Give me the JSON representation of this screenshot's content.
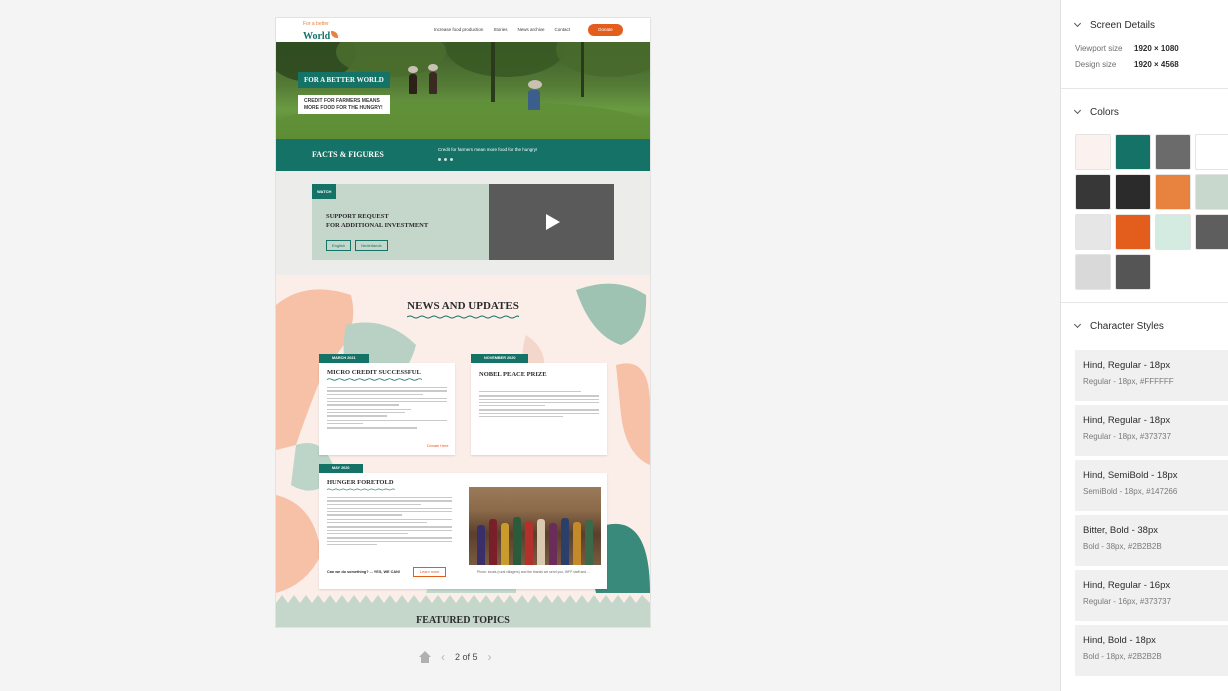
{
  "artboard": {
    "nav": {
      "logo_tag": "For a better",
      "logo_word": "World",
      "links": [
        "Increase food production",
        "Stories",
        "News archive",
        "Contact"
      ],
      "donate_label": "Donate"
    },
    "hero": {
      "badge": "FOR A BETTER WORLD",
      "subtitle": "CREDIT FOR FARMERS MEANS MORE FOOD FOR THE HUNGRY!"
    },
    "facts": {
      "title": "FACTS & FIGURES",
      "text": "Credit for farmers mean more food for the hungry!"
    },
    "watch": {
      "tag": "WATCH",
      "heading_line1": "SUPPORT REQUEST",
      "heading_line2": "FOR ADDITIONAL INVESTMENT",
      "lang1": "English",
      "lang2": "Nederlands"
    },
    "news": {
      "title": "NEWS AND UPDATES",
      "cards": [
        {
          "date": "MARCH 2021",
          "title": "MICRO CREDIT SUCCESSFUL",
          "more": "Donate Here"
        },
        {
          "date": "NOVEMBER 2020",
          "title": "NOBEL PEACE PRIZE"
        },
        {
          "date": "MAY 2020",
          "title": "HUNGER FORETOLD",
          "cta": "Can we do something? ... YES, WE CAN!",
          "learn": "Learn more",
          "caption": "Photo: locals (rural villagers) and the thanks we send you, WFP staff and ..."
        }
      ]
    },
    "featured": "FEATURED TOPICS"
  },
  "pager": {
    "page_count": "2 of 5"
  },
  "panel": {
    "screen_details": {
      "title": "Screen Details",
      "viewport_label": "Viewport size",
      "viewport_value": "1920 × 1080",
      "design_label": "Design size",
      "design_value": "1920 × 4568"
    },
    "colors": {
      "title": "Colors",
      "swatches": [
        "#fbf1ee",
        "#147266",
        "#6b6b6b",
        "#ffffff",
        "#373737",
        "#2b2b2b",
        "#e8823f",
        "#c8d8cc",
        "#e6e6e6",
        "#e35d1d",
        "#d4ebe1",
        "#5e5e5e",
        "#d9d9d9",
        "#555555"
      ]
    },
    "character_styles": {
      "title": "Character Styles",
      "styles": [
        {
          "name": "Hind, Regular - 18px",
          "desc": "Regular - 18px, #FFFFFF"
        },
        {
          "name": "Hind, Regular - 18px",
          "desc": "Regular - 18px, #373737"
        },
        {
          "name": "Hind, SemiBold - 18px",
          "desc": "SemiBold - 18px, #147266"
        },
        {
          "name": "Bitter, Bold - 38px",
          "desc": "Bold - 38px, #2B2B2B"
        },
        {
          "name": "Hind, Regular - 16px",
          "desc": "Regular - 16px, #373737"
        },
        {
          "name": "Hind, Bold - 18px",
          "desc": "Bold - 18px, #2B2B2B"
        }
      ]
    }
  }
}
